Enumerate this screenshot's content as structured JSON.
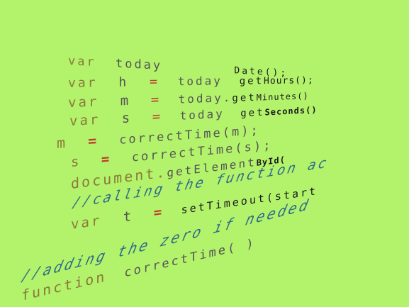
{
  "colors": {
    "background": "#b3f26b",
    "keyword": "#8a7a3a",
    "operator": "#c0392b",
    "identifier": "#555555",
    "dark": "#1a1a1a",
    "comment": "#2e6b8a"
  },
  "code": {
    "l1": {
      "kw": "var",
      "rest": "today",
      "tail": "Date();"
    },
    "l2": {
      "kw": "var",
      "name": "h",
      "op": "=",
      "obj": "today",
      "method": "get",
      "call": "Hours();"
    },
    "l3": {
      "kw": "var",
      "name": "m",
      "op": "=",
      "obj": "today.",
      "method": "get",
      "call": "Minutes()"
    },
    "l4": {
      "kw": "var",
      "name": "s",
      "op": "=",
      "obj": "today",
      "method": "get",
      "call": "Seconds()"
    },
    "l5": {
      "name": "m",
      "op": "=",
      "call": "correctTime(m);"
    },
    "l6": {
      "name": "s",
      "op": "=",
      "call": "correctTime(s);"
    },
    "l7": {
      "obj": "document.",
      "method": "getElement",
      "call": "ById("
    },
    "l8": {
      "comment": "//calling the function ac"
    },
    "l9": {
      "kw": "var",
      "name": "t",
      "op": "=",
      "call": "setTimeout(start"
    },
    "l10": {
      "comment": "//adding the zero if needed"
    },
    "l11": {
      "kw": "function",
      "call": "correctTime( )"
    }
  }
}
